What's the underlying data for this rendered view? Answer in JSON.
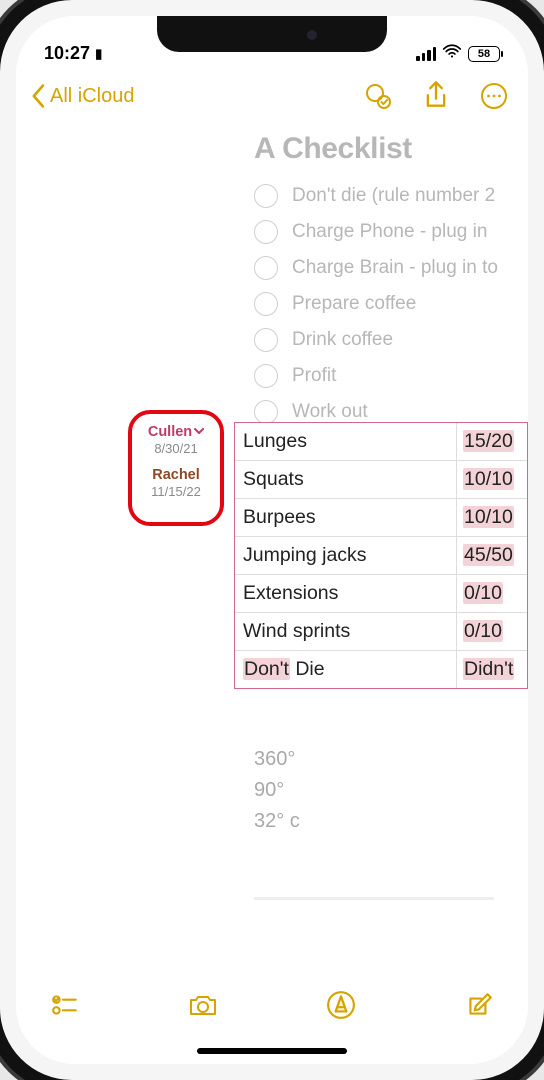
{
  "status": {
    "time": "10:27",
    "battery": "58"
  },
  "nav": {
    "back_label": "All iCloud"
  },
  "note": {
    "title": "A Checklist",
    "checklist": [
      "Don't die (rule number 2",
      "Charge Phone - plug in",
      "Charge Brain - plug in to",
      "Prepare coffee",
      "Drink coffee",
      "Profit",
      "Work out"
    ],
    "degrees": [
      "360°",
      "90°",
      "32° c"
    ]
  },
  "collaborators": [
    {
      "name": "Cullen",
      "date": "8/30/21"
    },
    {
      "name": "Rachel",
      "date": "11/15/22"
    }
  ],
  "table": [
    {
      "exercise": "Lunges",
      "count": "15/20"
    },
    {
      "exercise": "Squats",
      "count": "10/10"
    },
    {
      "exercise": "Burpees",
      "count": "10/10"
    },
    {
      "exercise": "Jumping jacks",
      "count": "45/50"
    },
    {
      "exercise": "Extensions",
      "count": "0/10"
    },
    {
      "exercise": "Wind sprints",
      "count": "0/10"
    },
    {
      "exercise_hl": "Don't",
      "exercise_rest": " Die",
      "count": "Didn't"
    }
  ]
}
